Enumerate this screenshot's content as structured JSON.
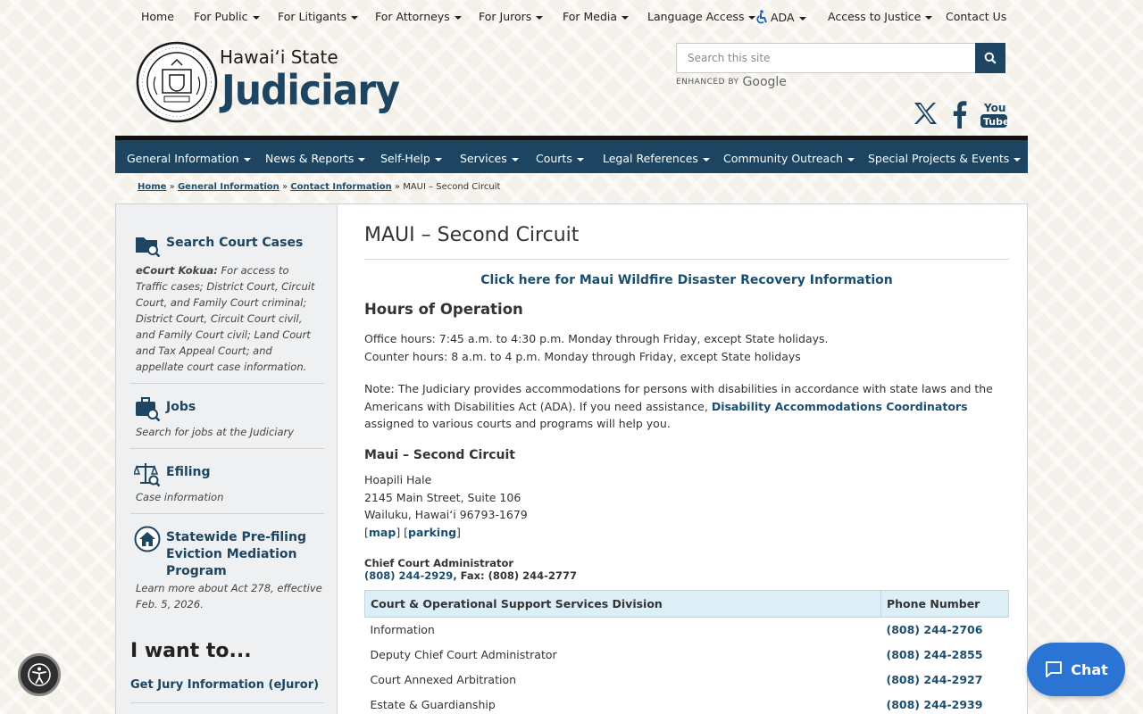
{
  "top_nav": [
    {
      "label": "Home",
      "dropdown": false
    },
    {
      "label": "For Public",
      "dropdown": true
    },
    {
      "label": "For Litigants",
      "dropdown": true
    },
    {
      "label": "For Attorneys",
      "dropdown": true
    },
    {
      "label": "For Jurors",
      "dropdown": true
    },
    {
      "label": "For Media",
      "dropdown": true
    },
    {
      "label": "Language Access",
      "dropdown": true
    },
    {
      "label": "ADA",
      "dropdown": true
    },
    {
      "label": "Access to Justice",
      "dropdown": true
    },
    {
      "label": "Contact Us",
      "dropdown": false
    }
  ],
  "logo": {
    "line1": "Hawaiʻi State",
    "line2": "Judiciary"
  },
  "search": {
    "placeholder": "Search this site",
    "enhanced_by": "ENHANCED BY",
    "google": "Google"
  },
  "main_nav": [
    "General Information",
    "News & Reports",
    "Self-Help",
    "Services",
    "Courts",
    "Legal References",
    "Community Outreach",
    "Special Projects & Events"
  ],
  "breadcrumb": {
    "home": "Home",
    "general": "General Information",
    "contact": "Contact Information",
    "sep": "»",
    "current": "MAUI – Second Circuit"
  },
  "sidebar": {
    "items": [
      {
        "title": "Search Court Cases",
        "desc_bold": "eCourt Kokua:",
        "desc": " For access to Traffic cases; District Court, Circuit Court, and Family Court criminal; District Court, Circuit Court civil, and Family Court civil; Land Court and Tax Appeal Court; and appellate court case information."
      },
      {
        "title": "Jobs",
        "desc": "Search for jobs at the Judiciary"
      },
      {
        "title": "Efiling",
        "desc": "Case information"
      },
      {
        "title": "Statewide Pre-filing Eviction Mediation Program",
        "desc": "Learn more about Act 278, effective Feb. 5, 2026."
      }
    ],
    "i_want": "I want to...",
    "jury_link": "Get Jury Information (eJuror)"
  },
  "content": {
    "title": "MAUI – Second Circuit",
    "wildfire_link": "Click here for Maui Wildfire Disaster Recovery Information",
    "hours_heading": "Hours of Operation",
    "office_hours": "Office hours: 7:45 a.m. to 4:30 p.m. Monday through Friday, except State holidays.",
    "counter_hours": "Counter hours: 8 a.m. to 4 p.m. Monday through Friday, except State holidays",
    "note_before": "Note: The Judiciary provides accommodations for persons with disabilities in accordance with state laws and the Americans with Disabilities Act (ADA). If you need assistance, ",
    "note_link": "Disability Accommodations Coordinators",
    "note_after": " assigned to various courts and programs will help you.",
    "section_heading": "Maui – Second Circuit",
    "address": [
      "Hoapili Hale",
      "2145 Main Street, Suite 106",
      "Wailuku, Hawaiʻi 96793-1679"
    ],
    "map_link": "map",
    "parking_link": "parking",
    "admin_label": "Chief Court Administrator",
    "admin_phone": "(808) 244-2929",
    "admin_fax": ", Fax: (808) 244-2777",
    "table": {
      "headers": [
        "Court & Operational Support Services Division",
        "Phone Number"
      ],
      "rows": [
        [
          "Information",
          "(808) 244-2706"
        ],
        [
          "Deputy Chief Court Administrator",
          "(808) 244-2855"
        ],
        [
          "Court Annexed Arbitration",
          "(808) 244-2927"
        ],
        [
          "Estate & Guardianship",
          "(808) 244-2939"
        ]
      ]
    }
  },
  "chat": {
    "label": "Chat"
  },
  "colors": {
    "brand": "#1d4561",
    "link": "#1b4f72",
    "chat": "#2c74d3",
    "table_header": "#dceef6"
  }
}
